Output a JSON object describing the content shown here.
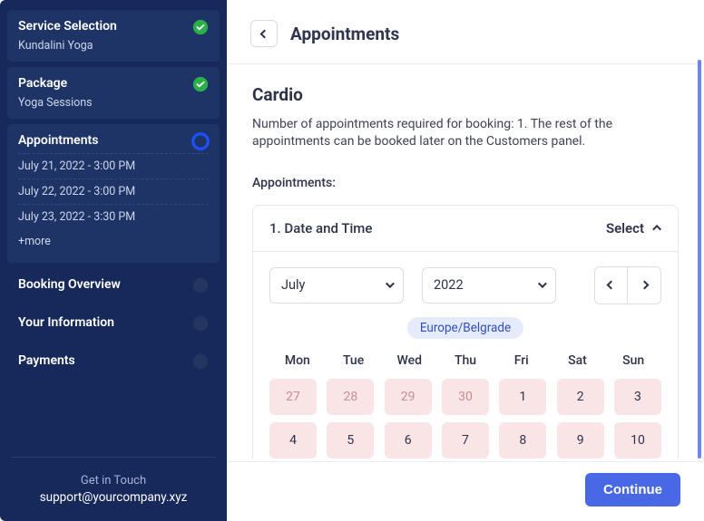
{
  "colors": {
    "accent": "#4868E6",
    "sidebar": "#17295A",
    "success": "#2BAF4A"
  },
  "sidebar": {
    "steps": [
      {
        "title": "Service Selection",
        "sub": "Kundalini Yoga",
        "status": "done"
      },
      {
        "title": "Package",
        "sub": "Yoga Sessions",
        "status": "done"
      },
      {
        "title": "Appointments",
        "status": "current",
        "items": [
          "July 21, 2022 - 3:00 PM",
          "July 22, 2022 - 3:00 PM",
          "July 23, 2022 - 3:30 PM"
        ],
        "more": "+more"
      },
      {
        "title": "Booking Overview",
        "status": "future"
      },
      {
        "title": "Your Information",
        "status": "future"
      },
      {
        "title": "Payments",
        "status": "future"
      }
    ],
    "contact_label": "Get in Touch",
    "contact_email": "support@yourcompany.xyz"
  },
  "header": {
    "title": "Appointments"
  },
  "main": {
    "service_title": "Cardio",
    "description": "Number of appointments required for booking: 1. The rest of the appointments can be booked later on the Customers panel.",
    "appointments_label": "Appointments:",
    "panel": {
      "step_label": "1. Date and Time",
      "select_label": "Select",
      "month": "July",
      "year": "2022",
      "timezone": "Europe/Belgrade",
      "weekdays": [
        "Mon",
        "Tue",
        "Wed",
        "Thu",
        "Fri",
        "Sat",
        "Sun"
      ],
      "rows": [
        [
          {
            "n": "27",
            "out": true
          },
          {
            "n": "28",
            "out": true
          },
          {
            "n": "29",
            "out": true
          },
          {
            "n": "30",
            "out": true
          },
          {
            "n": "1"
          },
          {
            "n": "2"
          },
          {
            "n": "3"
          }
        ],
        [
          {
            "n": "4"
          },
          {
            "n": "5"
          },
          {
            "n": "6"
          },
          {
            "n": "7"
          },
          {
            "n": "8"
          },
          {
            "n": "9"
          },
          {
            "n": "10"
          }
        ]
      ]
    }
  },
  "footer": {
    "continue": "Continue"
  }
}
